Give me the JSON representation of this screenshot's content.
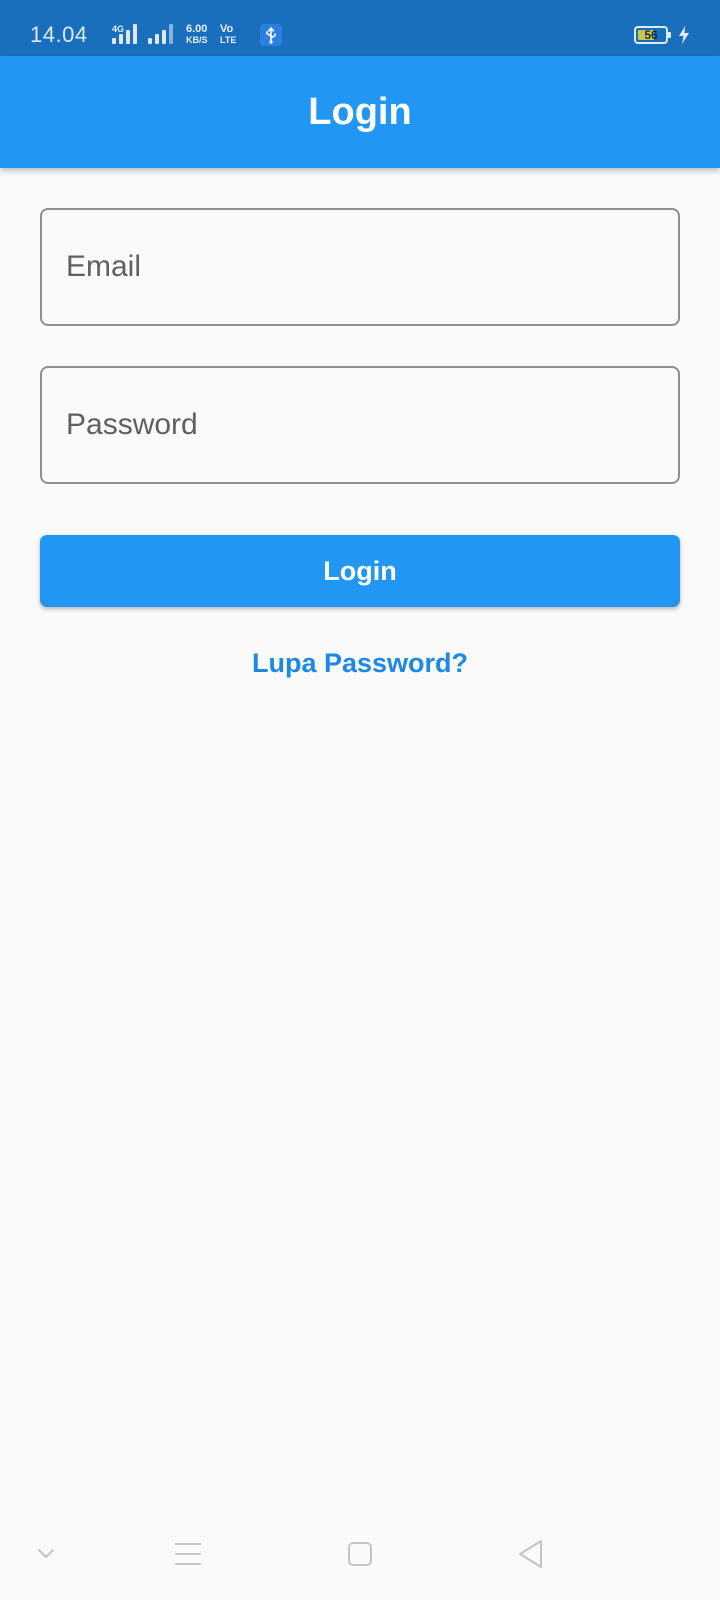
{
  "status_bar": {
    "time": "14.04",
    "network_type": "4G",
    "speed_value": "6.00",
    "speed_unit": "KB/S",
    "volte_top": "Vo",
    "volte_bottom": "LTE",
    "battery_level": "56"
  },
  "app_bar": {
    "title": "Login"
  },
  "form": {
    "email_placeholder": "Email",
    "password_placeholder": "Password",
    "login_button_label": "Login",
    "forgot_password_label": "Lupa Password?"
  },
  "nav_bar": {
    "icons": [
      "chevron-down-icon",
      "menu-icon",
      "home-square-icon",
      "back-triangle-icon"
    ]
  },
  "colors": {
    "primary": "#2196f3",
    "status_bar": "#1a6fbd",
    "link": "#1e88e5",
    "background": "#fafafa"
  }
}
